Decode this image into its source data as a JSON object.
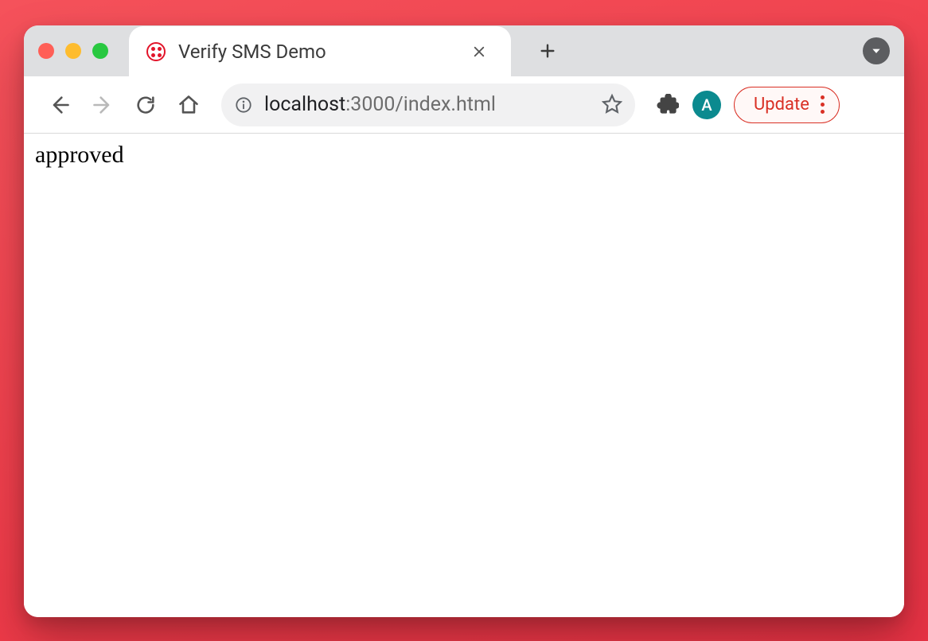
{
  "tab": {
    "title": "Verify SMS Demo",
    "favicon": "twilio-icon"
  },
  "toolbar": {
    "nav": {
      "back_enabled": true,
      "forward_enabled": false
    },
    "omnibox": {
      "host": "localhost",
      "rest": ":3000/index.html",
      "full": "localhost:3000/index.html"
    },
    "profile": {
      "initial": "A"
    },
    "update_label": "Update"
  },
  "page": {
    "body_text": "approved"
  }
}
